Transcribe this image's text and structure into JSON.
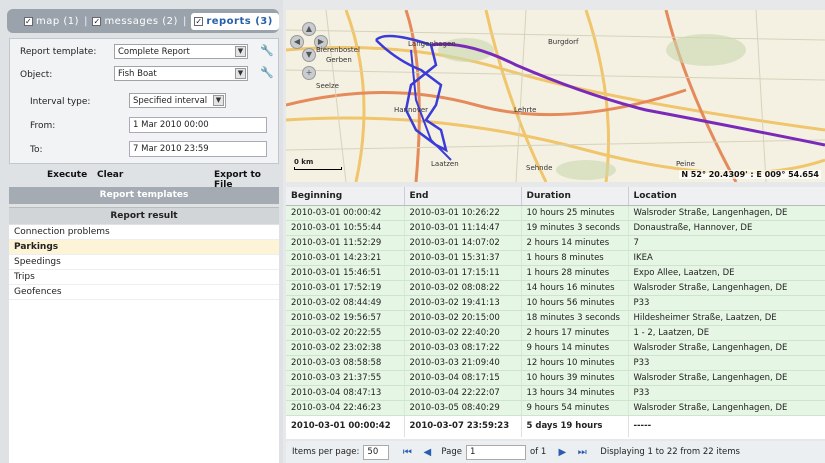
{
  "tabs": [
    {
      "label": "map (1)",
      "checked": true
    },
    {
      "label": "messages (2)",
      "checked": true
    },
    {
      "label": "reports (3)",
      "checked": true
    }
  ],
  "form": {
    "template_label": "Report template:",
    "template_value": "Complete Report",
    "object_label": "Object:",
    "object_value": "Fish Boat",
    "interval_label": "Interval type:",
    "interval_value": "Specified interval",
    "from_label": "From:",
    "from_value": "1 Mar 2010 00:00",
    "to_label": "To:",
    "to_value": "7 Mar 2010 23:59"
  },
  "actions": {
    "execute": "Execute",
    "clear": "Clear",
    "export": "Export to File"
  },
  "panels": {
    "templates": "Report templates",
    "result": "Report result"
  },
  "result_items": [
    "Connection problems",
    "Parkings",
    "Speedings",
    "Trips",
    "Geofences"
  ],
  "selected_result_index": 1,
  "map": {
    "coordinates": "N 52° 20.4309' : E 009° 54.654",
    "scale": "0 km",
    "places": [
      "Bierenbostel",
      "Gerben",
      "Langenhagen",
      "Burgdorf",
      "Seelze",
      "Hannover",
      "Lehrte",
      "Laatzen",
      "Sehnde",
      "Peine"
    ]
  },
  "table": {
    "columns": [
      "Beginning",
      "End",
      "Duration",
      "Location"
    ],
    "rows": [
      [
        "2010-03-01 00:00:42",
        "2010-03-01 10:26:22",
        "10 hours 25 minutes",
        "Walsroder Straße, Langenhagen, DE"
      ],
      [
        "2010-03-01 10:55:44",
        "2010-03-01 11:14:47",
        "19 minutes 3 seconds",
        "Donaustraße, Hannover, DE"
      ],
      [
        "2010-03-01 11:52:29",
        "2010-03-01 14:07:02",
        "2 hours 14 minutes",
        "7"
      ],
      [
        "2010-03-01 14:23:21",
        "2010-03-01 15:31:37",
        "1 hours 8 minutes",
        "IKEA"
      ],
      [
        "2010-03-01 15:46:51",
        "2010-03-01 17:15:11",
        "1 hours 28 minutes",
        "Expo Allee, Laatzen, DE"
      ],
      [
        "2010-03-01 17:52:19",
        "2010-03-02 08:08:22",
        "14 hours 16 minutes",
        "Walsroder Straße, Langenhagen, DE"
      ],
      [
        "2010-03-02 08:44:49",
        "2010-03-02 19:41:13",
        "10 hours 56 minutes",
        "P33"
      ],
      [
        "2010-03-02 19:56:57",
        "2010-03-02 20:15:00",
        "18 minutes 3 seconds",
        "Hildesheimer Straße, Laatzen, DE"
      ],
      [
        "2010-03-02 20:22:55",
        "2010-03-02 22:40:20",
        "2 hours 17 minutes",
        "1 - 2, Laatzen, DE"
      ],
      [
        "2010-03-02 23:02:38",
        "2010-03-03 08:17:22",
        "9 hours 14 minutes",
        "Walsroder Straße, Langenhagen, DE"
      ],
      [
        "2010-03-03 08:58:58",
        "2010-03-03 21:09:40",
        "12 hours 10 minutes",
        "P33"
      ],
      [
        "2010-03-03 21:37:55",
        "2010-03-04 08:17:15",
        "10 hours 39 minutes",
        "Walsroder Straße, Langenhagen, DE"
      ],
      [
        "2010-03-04 08:47:13",
        "2010-03-04 22:22:07",
        "13 hours 34 minutes",
        "P33"
      ],
      [
        "2010-03-04 22:46:23",
        "2010-03-05 08:40:29",
        "9 hours 54 minutes",
        "Walsroder Straße, Langenhagen, DE"
      ]
    ],
    "totals": [
      "2010-03-01 00:00:42",
      "2010-03-07 23:59:23",
      "5 days 19 hours",
      "-----"
    ]
  },
  "pager": {
    "per_page_label": "Items per page:",
    "per_page_value": "50",
    "page_label": "Page",
    "page_value": "1",
    "of_label": "of 1",
    "display_text": "Displaying 1 to 22 from 22 items"
  },
  "colors": {
    "route_blue": "#3b3bd8",
    "route_purple": "#7a2ab8",
    "row_green": "#e6f6e4",
    "tab_active": "#2860a8"
  }
}
